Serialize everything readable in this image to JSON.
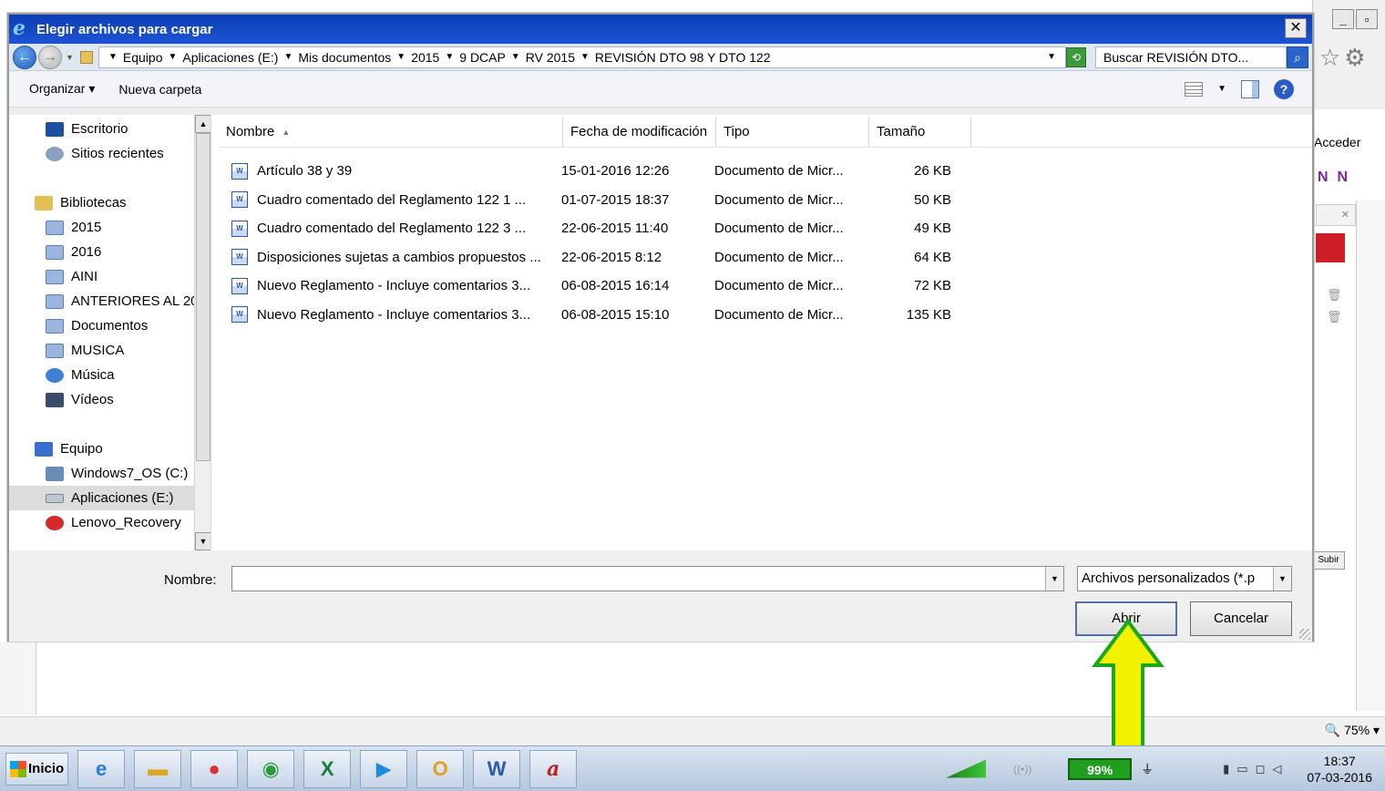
{
  "dialog": {
    "title": "Elegir archivos para cargar",
    "close_label": "✕",
    "breadcrumbs": [
      "Equipo",
      "Aplicaciones (E:)",
      "Mis documentos",
      "2015",
      "9 DCAP",
      "RV 2015",
      "REVISIÓN DTO 98 Y DTO 122"
    ],
    "search_placeholder": "Buscar REVISIÓN DTO...",
    "toolbar": {
      "organize": "Organizar ▾",
      "new_folder": "Nueva carpeta"
    },
    "nav": {
      "items": [
        {
          "label": "Escritorio",
          "icon": "desktop-icon"
        },
        {
          "label": "Sitios recientes",
          "icon": "recent-places-icon"
        },
        {
          "label": "Bibliotecas",
          "icon": "libraries-icon"
        },
        {
          "label": "2015",
          "icon": "library-icon"
        },
        {
          "label": "2016",
          "icon": "library-icon"
        },
        {
          "label": "AINI",
          "icon": "library-icon"
        },
        {
          "label": "ANTERIORES AL 20",
          "icon": "library-icon"
        },
        {
          "label": "Documentos",
          "icon": "documents-icon"
        },
        {
          "label": "MUSICA",
          "icon": "library-icon"
        },
        {
          "label": "Música",
          "icon": "music-icon"
        },
        {
          "label": "Vídeos",
          "icon": "videos-icon"
        },
        {
          "label": "Equipo",
          "icon": "computer-icon"
        },
        {
          "label": "Windows7_OS (C:)",
          "icon": "drive-icon"
        },
        {
          "label": "Aplicaciones (E:)",
          "icon": "drive-icon"
        },
        {
          "label": "Lenovo_Recovery",
          "icon": "recovery-drive-icon"
        }
      ]
    },
    "columns": {
      "name": "Nombre",
      "date": "Fecha de modificación",
      "type": "Tipo",
      "size": "Tamaño"
    },
    "files": [
      {
        "name": "Artículo 38 y 39",
        "date": "15-01-2016 12:26",
        "type": "Documento de Micr...",
        "size": "26 KB"
      },
      {
        "name": "Cuadro comentado del Reglamento 122  1 ...",
        "date": "01-07-2015 18:37",
        "type": "Documento de Micr...",
        "size": "50 KB"
      },
      {
        "name": "Cuadro comentado del Reglamento 122  3 ...",
        "date": "22-06-2015 11:40",
        "type": "Documento de Micr...",
        "size": "49 KB"
      },
      {
        "name": "Disposiciones sujetas a cambios propuestos ...",
        "date": "22-06-2015 8:12",
        "type": "Documento de Micr...",
        "size": "64 KB"
      },
      {
        "name": "Nuevo Reglamento - Incluye comentarios 3...",
        "date": "06-08-2015 16:14",
        "type": "Documento de Micr...",
        "size": "72 KB"
      },
      {
        "name": "Nuevo Reglamento - Incluye comentarios 3...",
        "date": "06-08-2015 15:10",
        "type": "Documento de Micr...",
        "size": "135 KB"
      }
    ],
    "filename_label": "Nombre:",
    "filename_value": "",
    "filter_value": "Archivos personalizados (*.p",
    "open_label": "Abrir",
    "cancel_label": "Cancelar"
  },
  "background": {
    "acceder": "Acceder",
    "subir": "Subir",
    "zoom": "🔍 75%  ▾"
  },
  "taskbar": {
    "start_label": "Inicio",
    "battery": "99%",
    "time": "18:37",
    "date": "07-03-2016"
  },
  "colors": {
    "title_bar": "#1d54d4",
    "arrow_fill": "#f2f200",
    "arrow_stroke": "#1aa81a",
    "battery": "#1f9e1f"
  }
}
